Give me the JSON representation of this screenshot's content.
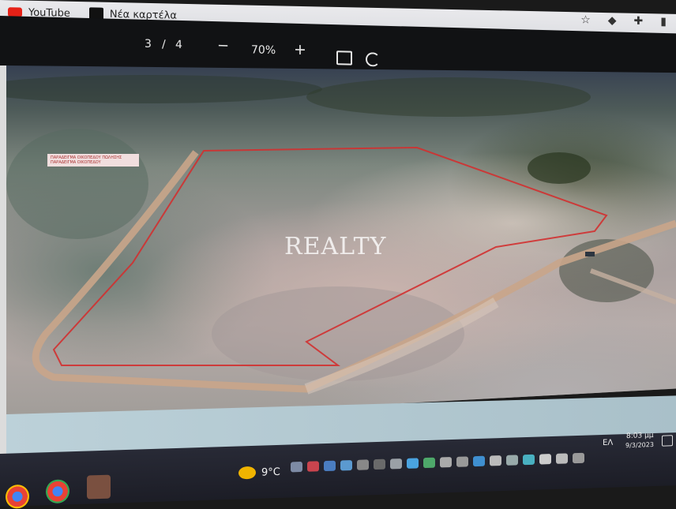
{
  "bookmarks": {
    "youtube_label": "YouTube",
    "new_tab_label": "Νέα καρτέλα"
  },
  "pdf_toolbar": {
    "page_current": "3",
    "page_separator": "/",
    "page_total": "4",
    "zoom_out": "−",
    "zoom_level": "70%",
    "zoom_in": "+",
    "download_icon": "download-icon",
    "print_icon": "print-icon"
  },
  "photo": {
    "watermark": "REALTY",
    "plot_label": "ΠΑΡΑΔΕΙΓΜΑ ΟΙΚΟΠΕΔΟΥ ΠΩΛΗΣΗΣ ΠΑΡΑΔΕΙΓΜΑ ΟΙΚΟΠΕΔΟΥ",
    "boundary_color": "#d23030"
  },
  "taskbar": {
    "weather_temp": "9°C",
    "language": "ΕΛ",
    "time": "8:03 μμ",
    "date": "9/3/2023"
  }
}
